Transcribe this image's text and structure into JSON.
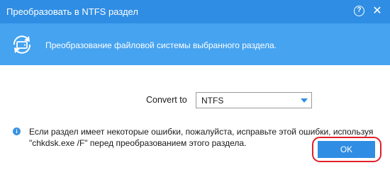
{
  "window": {
    "title": "Преобразовать в NTFS раздел",
    "help_glyph": "?",
    "close_glyph": "✕"
  },
  "header": {
    "icon": "convert-disk-icon",
    "description": "Преобразование файловой системы выбранного раздела."
  },
  "convert": {
    "label": "Convert to",
    "selected": "NTFS"
  },
  "warning": {
    "icon": "info-icon",
    "glyph": "i",
    "line1": "Если раздел имеет некоторые ошибки, пожалуйста, исправьте этой ошибки, используя",
    "line2": "\"chkdsk.exe /F\" перед преобразованием этого раздела."
  },
  "buttons": {
    "ok_label": "OK"
  },
  "colors": {
    "titlebar": "#2f8de3",
    "header_band": "#45a3f0",
    "accent": "#2f8de3",
    "highlight_ring": "#e0202a"
  }
}
